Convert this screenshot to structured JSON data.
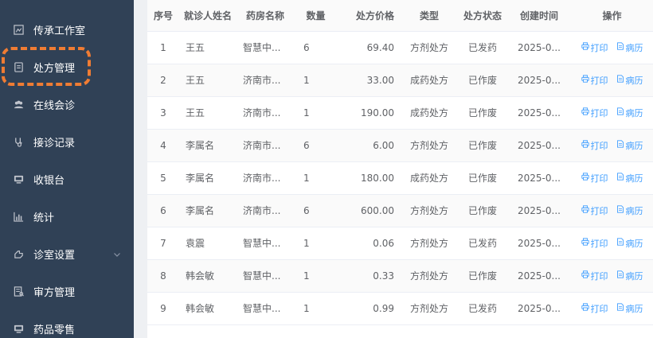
{
  "sidebar": {
    "items": [
      {
        "label": "传承工作室",
        "icon": "studio-icon"
      },
      {
        "label": "处方管理",
        "icon": "prescription-icon"
      },
      {
        "label": "在线会诊",
        "icon": "consultation-icon"
      },
      {
        "label": "接诊记录",
        "icon": "stethoscope-icon"
      },
      {
        "label": "收银台",
        "icon": "cashier-icon"
      },
      {
        "label": "统计",
        "icon": "chart-icon"
      },
      {
        "label": "诊室设置",
        "icon": "settings-icon"
      },
      {
        "label": "审方管理",
        "icon": "review-icon"
      },
      {
        "label": "药品零售",
        "icon": "retail-icon"
      }
    ],
    "active": "处方管理",
    "accent_color": "#f07c33",
    "background": "#304156"
  },
  "table": {
    "headers": [
      "序号",
      "就诊人姓名",
      "药房名称",
      "数量",
      "处方价格",
      "类型",
      "处方状态",
      "创建时间",
      "操作"
    ],
    "rows": [
      {
        "no": "1",
        "patient": "王五",
        "pharmacy": "智慧中...",
        "qty": "6",
        "price": "69.40",
        "type": "方剂处方",
        "status": "已发药",
        "created": "2025-0..."
      },
      {
        "no": "2",
        "patient": "王五",
        "pharmacy": "济南市...",
        "qty": "1",
        "price": "33.00",
        "type": "成药处方",
        "status": "已作废",
        "created": "2025-0..."
      },
      {
        "no": "3",
        "patient": "王五",
        "pharmacy": "济南市...",
        "qty": "1",
        "price": "190.00",
        "type": "成药处方",
        "status": "已作废",
        "created": "2025-0..."
      },
      {
        "no": "4",
        "patient": "李属名",
        "pharmacy": "济南市...",
        "qty": "6",
        "price": "6.00",
        "type": "方剂处方",
        "status": "已作废",
        "created": "2025-0..."
      },
      {
        "no": "5",
        "patient": "李属名",
        "pharmacy": "济南市...",
        "qty": "1",
        "price": "180.00",
        "type": "成药处方",
        "status": "已作废",
        "created": "2025-0..."
      },
      {
        "no": "6",
        "patient": "李属名",
        "pharmacy": "济南市...",
        "qty": "6",
        "price": "600.00",
        "type": "方剂处方",
        "status": "已作废",
        "created": "2025-0..."
      },
      {
        "no": "7",
        "patient": "袁震",
        "pharmacy": "智慧中...",
        "qty": "1",
        "price": "0.06",
        "type": "方剂处方",
        "status": "已发药",
        "created": "2025-0..."
      },
      {
        "no": "8",
        "patient": "韩会敏",
        "pharmacy": "智慧中...",
        "qty": "1",
        "price": "0.33",
        "type": "方剂处方",
        "status": "已作废",
        "created": "2025-0..."
      },
      {
        "no": "9",
        "patient": "韩会敏",
        "pharmacy": "智慧中...",
        "qty": "1",
        "price": "0.99",
        "type": "方剂处方",
        "status": "已发药",
        "created": "2025-0..."
      }
    ],
    "actions": {
      "print_label": "打印",
      "record_label": "病历",
      "print_icon": "print-icon",
      "record_icon": "document-icon",
      "link_color": "#409eff"
    }
  }
}
